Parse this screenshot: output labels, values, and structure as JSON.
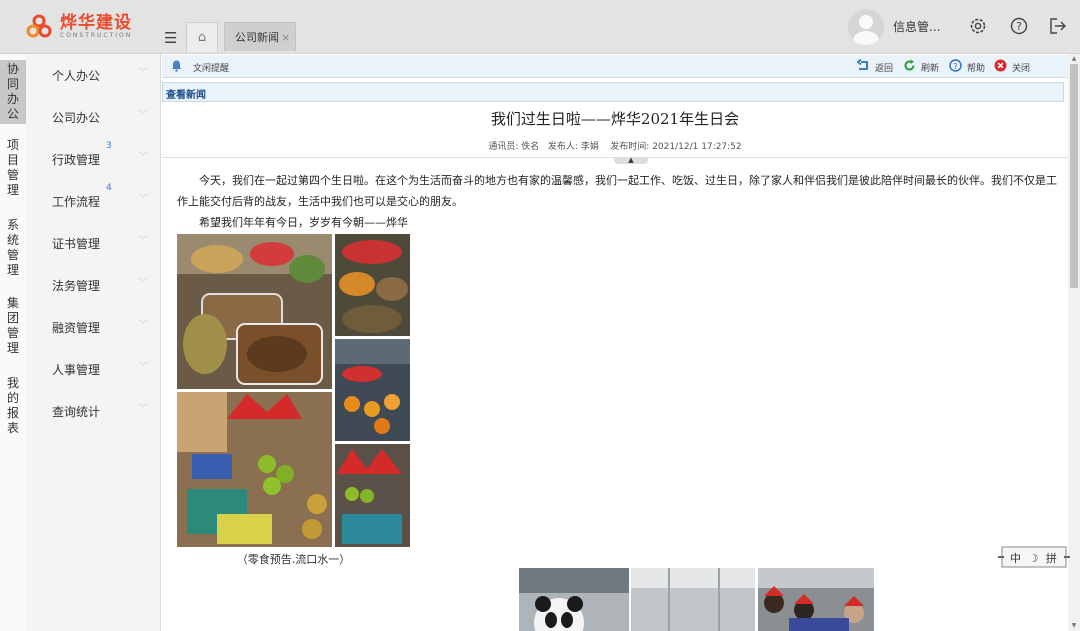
{
  "header": {
    "logo_cn": "烨华建设",
    "logo_en": "CONSTRUCTION",
    "tabs": [
      {
        "icon": "home-icon"
      },
      {
        "label": "公司新闻",
        "close": "×"
      }
    ],
    "username": "信息管...",
    "icons": [
      "settings-icon",
      "help-icon",
      "logout-icon"
    ]
  },
  "rail": [
    {
      "label": "协同办公",
      "active": true
    },
    {
      "label": "项目管理"
    },
    {
      "label": "系统管理"
    },
    {
      "label": "集团管理"
    },
    {
      "label": "我的报表"
    }
  ],
  "sidebar": [
    {
      "label": "个人办公"
    },
    {
      "label": "公司办公"
    },
    {
      "label": "行政管理",
      "badge": "3"
    },
    {
      "label": "工作流程",
      "badge": "4"
    },
    {
      "label": "证书管理"
    },
    {
      "label": "法务管理"
    },
    {
      "label": "融资管理"
    },
    {
      "label": "人事管理"
    },
    {
      "label": "查询统计"
    }
  ],
  "toolbar": {
    "reminder": "文闲提醒",
    "back": "返回",
    "refresh": "刷新",
    "help": "帮助",
    "close": "关闭"
  },
  "section_title": "查看新闻",
  "article": {
    "title": "我们过生日啦——烨华2021年生日会",
    "meta": {
      "reporter_label": "通讯员:",
      "reporter": "佚名",
      "publisher_label": "发布人:",
      "publisher": "李娟",
      "time_label": "发布时间:",
      "time": "2021/12/1 17:27:52"
    },
    "paragraph1": "今天，我们在一起过第四个生日啦。在这个为生活而奋斗的地方也有家的温馨感，我们一起工作、吃饭、过生日，除了家人和伴侣我们是彼此陪伴时间最长的伙伴。我们不仅是工作上能交付后背的战友，生活中我们也可以是交心的朋友。",
    "paragraph2": "希望我们年年有今日，岁岁有今朝——烨华",
    "caption": "（零食预告.流口水一）"
  },
  "ime": "中 ☽ 拼",
  "colors": {
    "brand": "#e84c2d",
    "link": "#1f4e8c",
    "badge": "#3d7bd6"
  }
}
